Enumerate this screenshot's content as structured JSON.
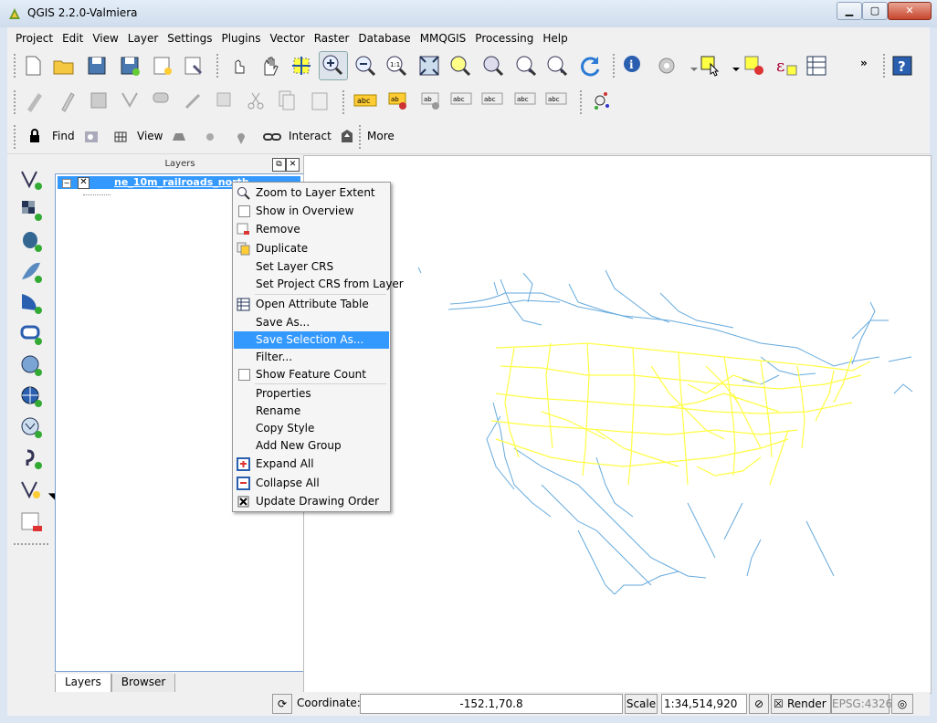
{
  "window": {
    "title": "QGIS 2.2.0-Valmiera",
    "min_label": "▁",
    "max_label": "▢",
    "close_label": "✕"
  },
  "menubar": {
    "items": [
      "Project",
      "Edit",
      "View",
      "Layer",
      "Settings",
      "Plugins",
      "Vector",
      "Raster",
      "Database",
      "MMQGIS",
      "Processing",
      "Help"
    ]
  },
  "toolbar3": {
    "find_label": "Find",
    "view_label": "View",
    "interact_label": "Interact",
    "more_label": "More",
    "overflow_label": "»"
  },
  "layers_panel": {
    "title": "Layers",
    "layer_name": "ne_10m_railroads_north",
    "tabs": [
      "Layers",
      "Browser"
    ]
  },
  "context_menu": {
    "items": [
      {
        "label": "Zoom to Layer Extent",
        "icon": "zoom-icon"
      },
      {
        "label": "Show in Overview",
        "icon": "checkbox"
      },
      {
        "label": "Remove",
        "icon": "remove-icon"
      },
      {
        "label": "Duplicate",
        "icon": "duplicate-icon"
      },
      {
        "label": "Set Layer CRS",
        "icon": ""
      },
      {
        "label": "Set Project CRS from Layer",
        "icon": ""
      },
      {
        "label": "Open Attribute Table",
        "icon": "table-icon"
      },
      {
        "label": "Save As...",
        "icon": ""
      },
      {
        "label": "Save Selection As...",
        "icon": ""
      },
      {
        "label": "Filter...",
        "icon": ""
      },
      {
        "label": "Show Feature Count",
        "icon": "checkbox"
      },
      {
        "label": "Properties",
        "icon": ""
      },
      {
        "label": "Rename",
        "icon": ""
      },
      {
        "label": "Copy Style",
        "icon": ""
      },
      {
        "label": "Add New Group",
        "icon": ""
      },
      {
        "label": "Expand All",
        "icon": "expand-icon"
      },
      {
        "label": "Collapse All",
        "icon": "collapse-icon"
      },
      {
        "label": "Update Drawing Order",
        "icon": "check-icon"
      }
    ],
    "highlighted": "Save Selection As..."
  },
  "statusbar": {
    "coordinate_label": "Coordinate:",
    "coordinate_value": "-152.1,70.8",
    "scale_label": "Scale",
    "scale_value": "1:34,514,920",
    "render_label": "Render",
    "crs_label": "EPSG:4326"
  },
  "colors": {
    "yellow_lines": "#ffff44",
    "blue_lines": "#66aadd",
    "highlight": "#3399ff"
  }
}
